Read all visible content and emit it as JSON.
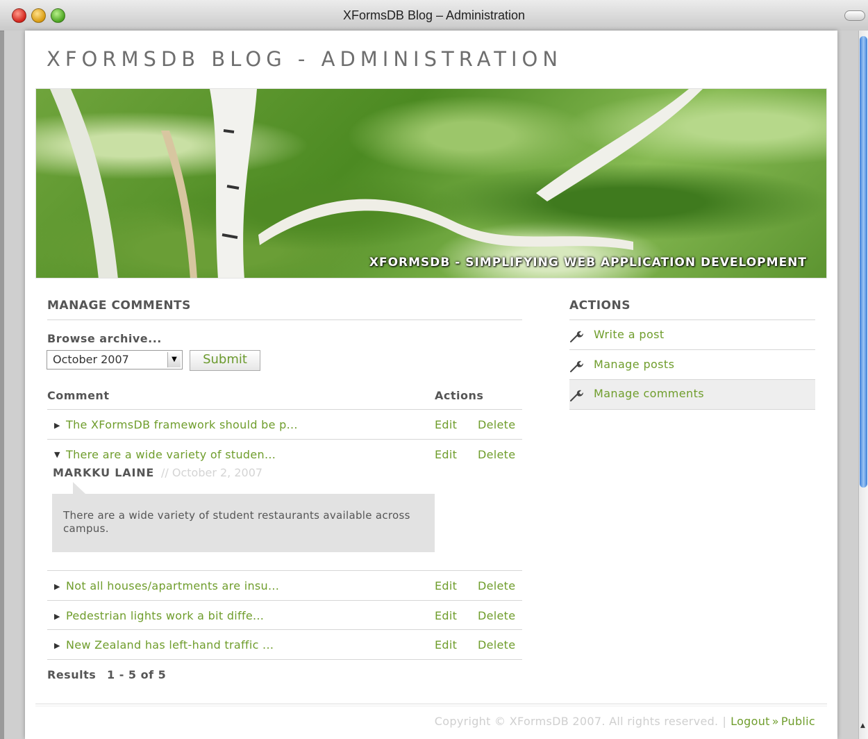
{
  "window": {
    "title": "XFormsDB Blog – Administration"
  },
  "site": {
    "title": "XFORMSDB BLOG - ADMINISTRATION",
    "tagline": "XFORMSDB - SIMPLIFYING WEB APPLICATION DEVELOPMENT"
  },
  "manage": {
    "heading": "MANAGE COMMENTS",
    "browse_label": "Browse archive...",
    "archive_selected": "October 2007",
    "submit_label": "Submit",
    "columns": {
      "comment": "Comment",
      "actions": "Actions"
    },
    "rows": [
      {
        "title": "The XFormsDB framework should be p...",
        "expanded": false,
        "edit": "Edit",
        "delete": "Delete"
      },
      {
        "title": "There are a wide variety of studen...",
        "expanded": true,
        "edit": "Edit",
        "delete": "Delete"
      },
      {
        "title": "Not all houses/apartments are insu...",
        "expanded": false,
        "edit": "Edit",
        "delete": "Delete"
      },
      {
        "title": "Pedestrian lights work a bit diffe...",
        "expanded": false,
        "edit": "Edit",
        "delete": "Delete"
      },
      {
        "title": "New Zealand has left-hand traffic ...",
        "expanded": false,
        "edit": "Edit",
        "delete": "Delete"
      }
    ],
    "expanded_comment": {
      "author": "MARKKU LAINE",
      "date": "// October 2, 2007",
      "body": "There are a wide variety of student restaurants available across campus."
    },
    "results_label": "Results",
    "results_range": "1 - 5 of 5"
  },
  "actions": {
    "heading": "ACTIONS",
    "items": [
      {
        "label": "Write a post",
        "icon": "wrench-icon",
        "active": false
      },
      {
        "label": "Manage posts",
        "icon": "wrench-icon",
        "active": false
      },
      {
        "label": "Manage comments",
        "icon": "wrench-icon",
        "active": true
      }
    ]
  },
  "footer": {
    "copyright": "Copyright © XFormsDB 2007. All rights reserved.",
    "separator": "|",
    "logout": "Logout",
    "arrow": "»",
    "public": "Public"
  },
  "colors": {
    "link": "#6f9d2c",
    "heading": "#555555",
    "muted": "#cfcfcf"
  }
}
